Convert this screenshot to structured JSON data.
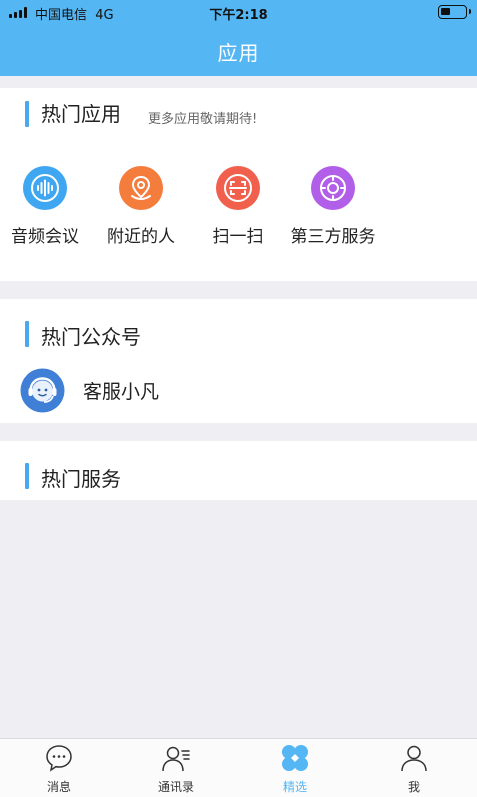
{
  "status_bar": {
    "carrier": "中国电信",
    "network": "4G",
    "time": "下午2:18"
  },
  "header": {
    "title": "应用"
  },
  "hot_apps": {
    "title": "热门应用",
    "subtitle": "更多应用敬请期待!",
    "items": [
      {
        "label": "音频会议",
        "icon": "audio-wave-icon",
        "color": "#3fa6f1"
      },
      {
        "label": "附近的人",
        "icon": "location-pin-icon",
        "color": "#f47c3c"
      },
      {
        "label": "扫一扫",
        "icon": "scan-icon",
        "color": "#f0604d"
      },
      {
        "label": "第三方服务",
        "icon": "third-party-icon",
        "color": "#b15ee8"
      }
    ]
  },
  "hot_official_accounts": {
    "title": "热门公众号",
    "items": [
      {
        "name": "客服小凡",
        "icon": "customer-service-avatar",
        "color": "#3f7fd6"
      }
    ]
  },
  "hot_services": {
    "title": "热门服务"
  },
  "tabbar": {
    "active_color": "#55b6f4",
    "items": [
      {
        "label": "消息",
        "icon": "message-icon"
      },
      {
        "label": "通讯录",
        "icon": "contacts-icon"
      },
      {
        "label": "精选",
        "icon": "featured-icon",
        "active": true
      },
      {
        "label": "我",
        "icon": "profile-icon"
      }
    ]
  }
}
